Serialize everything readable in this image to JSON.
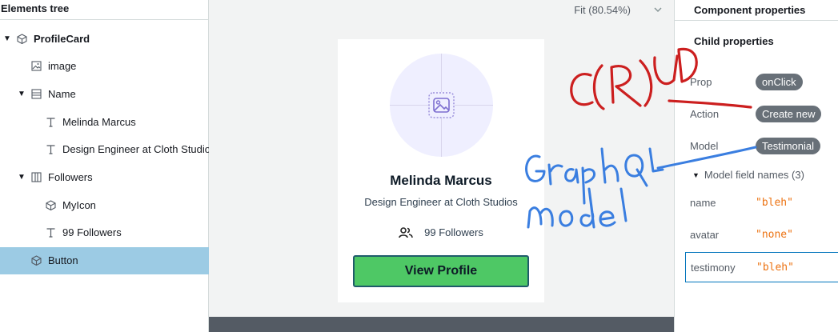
{
  "tree": {
    "header": "Elements tree",
    "items": [
      {
        "label": "ProfileCard",
        "icon": "component-icon",
        "expand": "expanded",
        "depth": 0,
        "bold": true
      },
      {
        "label": "image",
        "icon": "image-icon",
        "expand": "none",
        "depth": 1
      },
      {
        "label": "Name",
        "icon": "flex-column-icon",
        "expand": "expanded",
        "depth": 1
      },
      {
        "label": "Melinda Marcus",
        "icon": "text-icon",
        "expand": "none",
        "depth": 2
      },
      {
        "label": "Design Engineer at Cloth Studios",
        "icon": "text-icon",
        "expand": "none",
        "depth": 2
      },
      {
        "label": "Followers",
        "icon": "flex-row-icon",
        "expand": "expanded",
        "depth": 1
      },
      {
        "label": "MyIcon",
        "icon": "component-icon",
        "expand": "none",
        "depth": 2
      },
      {
        "label": "99 Followers",
        "icon": "text-icon",
        "expand": "none",
        "depth": 2
      },
      {
        "label": "Button",
        "icon": "component-icon",
        "expand": "none",
        "depth": 1,
        "selected": true
      }
    ]
  },
  "canvas": {
    "zoom_label": "Fit (80.54%)",
    "card": {
      "name": "Melinda Marcus",
      "role": "Design Engineer at Cloth Studios",
      "followers": "99 Followers",
      "button": "View Profile"
    }
  },
  "props": {
    "title": "Component properties",
    "child_title": "Child properties",
    "rows": [
      {
        "label": "Prop",
        "value": "onClick"
      },
      {
        "label": "Action",
        "value": "Create new"
      },
      {
        "label": "Model",
        "value": "Testimonial"
      }
    ],
    "model_fields_label": "Model field names (3)",
    "fields": [
      {
        "name": "name",
        "value": "\"bleh\""
      },
      {
        "name": "avatar",
        "value": "\"none\""
      },
      {
        "name": "testimony",
        "value": "\"bleh\""
      }
    ]
  },
  "colors": {
    "selected_row": "#9ccbe4",
    "button_green": "#4ec865",
    "pill_gray": "#687078",
    "field_value_orange": "#ec7211",
    "annotation_red": "#cc1f1f",
    "annotation_blue": "#3a7ee0"
  }
}
